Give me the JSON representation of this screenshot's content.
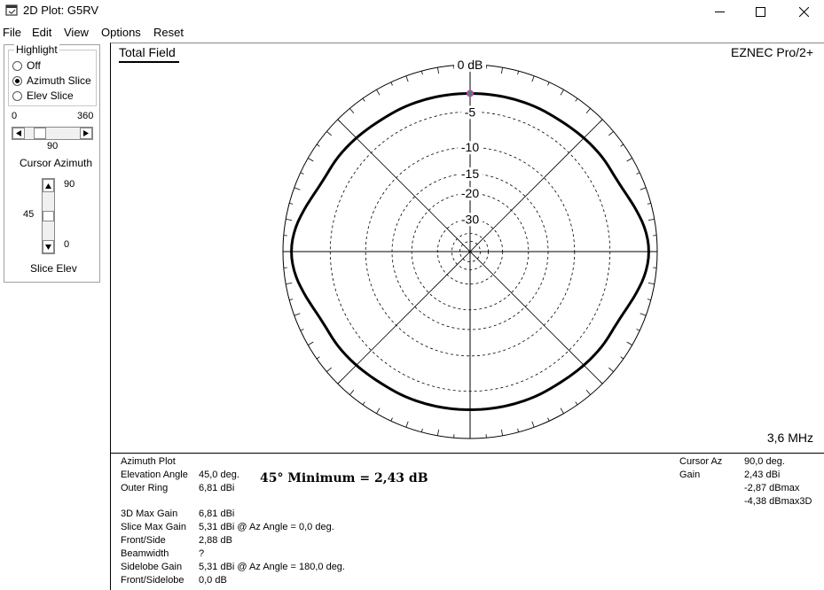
{
  "window": {
    "title": "2D Plot: G5RV",
    "icon": "plot-window-icon"
  },
  "menu": [
    "File",
    "Edit",
    "View",
    "Options",
    "Reset"
  ],
  "highlight": {
    "label": "Highlight",
    "options": [
      {
        "label": "Off",
        "selected": false
      },
      {
        "label": "Azimuth Slice",
        "selected": true
      },
      {
        "label": "Elev Slice",
        "selected": false
      }
    ]
  },
  "cursor_azimuth": {
    "min": "0",
    "max": "360",
    "value": "90",
    "label": "Cursor Azimuth"
  },
  "slice_elev": {
    "max": "90",
    "min": "0",
    "value": "45",
    "label": "Slice Elev"
  },
  "plot": {
    "title": "Total Field",
    "brand": "EZNEC Pro/2+",
    "frequency": "3,6 MHz",
    "ring_labels": [
      "0 dB",
      "-5",
      "-10",
      "-15",
      "-20",
      "-30"
    ],
    "colors": {
      "pattern": "#000000",
      "cursor_marker": "#c040c0",
      "cursor_dot": "#20a040"
    }
  },
  "chart_data": {
    "type": "polar",
    "title": "Total Field",
    "rings_db": [
      0,
      -5,
      -10,
      -15,
      -20,
      -30
    ],
    "radial_scale": "log-periodic dB",
    "series": [
      {
        "points": [
          {
            "az": 0,
            "db": -2.87
          },
          {
            "az": 30,
            "db": -2.8
          },
          {
            "az": 60,
            "db": -2.4
          },
          {
            "az": 90,
            "db": -0.8
          },
          {
            "az": 120,
            "db": -2.4
          },
          {
            "az": 150,
            "db": -2.8
          },
          {
            "az": 180,
            "db": -2.87
          },
          {
            "az": 210,
            "db": -2.8
          },
          {
            "az": 240,
            "db": -2.4
          },
          {
            "az": 270,
            "db": -0.8
          },
          {
            "az": 300,
            "db": -2.4
          },
          {
            "az": 330,
            "db": -2.8
          }
        ]
      }
    ],
    "cursor_azimuth": 90
  },
  "info_left": {
    "heading": "Azimuth Plot",
    "rows1": [
      {
        "label": "Elevation Angle",
        "value": "45,0 deg."
      },
      {
        "label": "Outer Ring",
        "value": "6,81 dBi"
      }
    ],
    "rows2": [
      {
        "label": "3D Max Gain",
        "value": "6,81 dBi"
      },
      {
        "label": "Slice Max Gain",
        "value": "5,31 dBi @ Az Angle = 0,0 deg."
      },
      {
        "label": "Front/Side",
        "value": "2,88 dB"
      },
      {
        "label": "Beamwidth",
        "value": "?"
      },
      {
        "label": "Sidelobe Gain",
        "value": "5,31 dBi @ Az Angle = 180,0 deg."
      },
      {
        "label": "Front/Sidelobe",
        "value": "0,0 dB"
      }
    ]
  },
  "annotation": "45° Minimum = 2,43 dB",
  "info_right": {
    "cursor_az_label": "Cursor Az",
    "cursor_az_value": "90,0 deg.",
    "gain_label": "Gain",
    "gain_values": [
      "2,43 dBi",
      "-2,87 dBmax",
      "-4,38 dBmax3D"
    ]
  }
}
